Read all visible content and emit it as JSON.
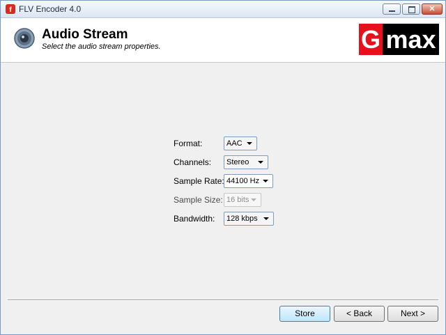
{
  "window": {
    "title": "FLV Encoder 4.0",
    "controls": {
      "minimize": "_",
      "maximize": "□",
      "close": "✕"
    }
  },
  "header": {
    "icon": "speaker-icon",
    "title": "Audio Stream",
    "subtitle": "Select the audio stream properties.",
    "logo_first": "G",
    "logo_rest": "max"
  },
  "form": {
    "format": {
      "label": "Format:",
      "value": "AAC"
    },
    "channels": {
      "label": "Channels:",
      "value": "Stereo"
    },
    "sample_rate": {
      "label": "Sample Rate:",
      "value": "44100 Hz"
    },
    "sample_size": {
      "label": "Sample Size:",
      "value": "16 bits",
      "enabled": false
    },
    "bandwidth": {
      "label": "Bandwidth:",
      "value": "128 kbps"
    }
  },
  "footer": {
    "store_label": "Store",
    "back_label": "< Back",
    "next_label": "Next >"
  },
  "colors": {
    "logo_red": "#e8101b",
    "logo_black": "#000000"
  }
}
